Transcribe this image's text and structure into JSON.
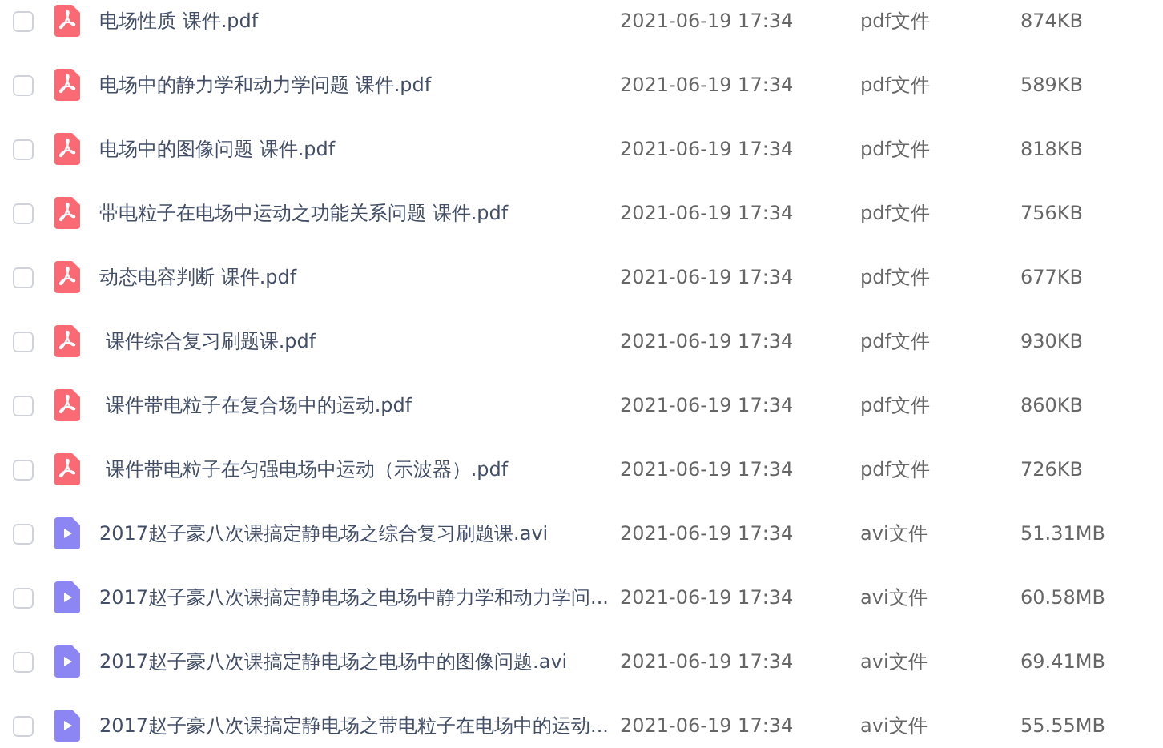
{
  "files": [
    {
      "kind": "pdf",
      "checked": false,
      "name": "电场性质 课件.pdf",
      "modified": "2021-06-19 17:34",
      "type": "pdf文件",
      "size": "874KB"
    },
    {
      "kind": "pdf",
      "checked": false,
      "name": "电场中的静力学和动力学问题 课件.pdf",
      "modified": "2021-06-19 17:34",
      "type": "pdf文件",
      "size": "589KB"
    },
    {
      "kind": "pdf",
      "checked": false,
      "name": "电场中的图像问题 课件.pdf",
      "modified": "2021-06-19 17:34",
      "type": "pdf文件",
      "size": "818KB"
    },
    {
      "kind": "pdf",
      "checked": false,
      "name": "带电粒子在电场中运动之功能关系问题 课件.pdf",
      "modified": "2021-06-19 17:34",
      "type": "pdf文件",
      "size": "756KB"
    },
    {
      "kind": "pdf",
      "checked": false,
      "name": "动态电容判断 课件.pdf",
      "modified": "2021-06-19 17:34",
      "type": "pdf文件",
      "size": "677KB"
    },
    {
      "kind": "pdf",
      "checked": false,
      "name": " 课件综合复习刷题课.pdf",
      "modified": "2021-06-19 17:34",
      "type": "pdf文件",
      "size": "930KB"
    },
    {
      "kind": "pdf",
      "checked": false,
      "name": " 课件带电粒子在复合场中的运动.pdf",
      "modified": "2021-06-19 17:34",
      "type": "pdf文件",
      "size": "860KB"
    },
    {
      "kind": "pdf",
      "checked": false,
      "name": " 课件带电粒子在匀强电场中运动（示波器）.pdf",
      "modified": "2021-06-19 17:34",
      "type": "pdf文件",
      "size": "726KB"
    },
    {
      "kind": "video",
      "checked": false,
      "name": "2017赵子豪八次课搞定静电场之综合复习刷题课.avi",
      "modified": "2021-06-19 17:34",
      "type": "avi文件",
      "size": "51.31MB"
    },
    {
      "kind": "video",
      "checked": false,
      "name": "2017赵子豪八次课搞定静电场之电场中静力学和动力学问...",
      "modified": "2021-06-19 17:34",
      "type": "avi文件",
      "size": "60.58MB"
    },
    {
      "kind": "video",
      "checked": false,
      "name": "2017赵子豪八次课搞定静电场之电场中的图像问题.avi",
      "modified": "2021-06-19 17:34",
      "type": "avi文件",
      "size": "69.41MB"
    },
    {
      "kind": "video",
      "checked": false,
      "name": "2017赵子豪八次课搞定静电场之带电粒子在电场中的运动...",
      "modified": "2021-06-19 17:34",
      "type": "avi文件",
      "size": "55.55MB"
    }
  ]
}
